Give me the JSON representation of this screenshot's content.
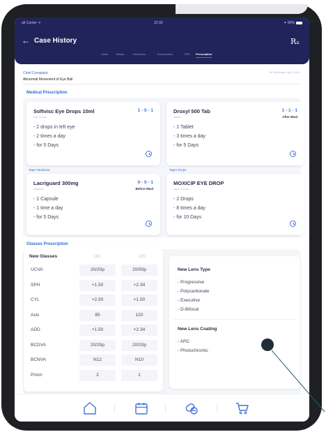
{
  "status": {
    "carrier": "atl Carrier ᯤ",
    "time": "22:33",
    "battery": "✦ 80%"
  },
  "header": {
    "back_symbol": "←",
    "title": "Case History",
    "rx_symbol": "Rₓ"
  },
  "tabs": [
    {
      "label": "Vitals",
      "active": false
    },
    {
      "label": "History",
      "active": false
    },
    {
      "label": "Refraction",
      "active": false
    },
    {
      "label": "Examination",
      "active": false
    },
    {
      "label": "PDC",
      "active": false
    },
    {
      "label": "Prescription",
      "active": true
    }
  ],
  "chief_complaint": {
    "label": "Chief Complaint",
    "meta": "Dr. Eric Brown | Sep 1 2021",
    "value": "Abnormal Movement of Eye Ball"
  },
  "medical_prescription": {
    "title": "Medical Prescription",
    "cards": [
      {
        "name": "Softvisc Eye Drops 10ml",
        "type": "Eye Drops",
        "dose": "1 - 0 - 1",
        "when": "",
        "lines": [
          "- 2 drops in left eye",
          "- 2 times a day",
          "- for 5 Days"
        ],
        "taper_label": "Taper Medicine"
      },
      {
        "name": "Droxyl 500 Tab",
        "type": "Tablet",
        "dose": "1 - 1 - 1",
        "when": "After Meal",
        "lines": [
          "- 1 Tablet",
          "- 3 times a day",
          "- for 5 Days"
        ],
        "taper_label": "Taper Drops"
      },
      {
        "name": "Lacriguard 300mg",
        "type": "Capsule",
        "dose": "0 - 0 - 1",
        "when": "Before Meal",
        "lines": [
          "- 1 Capsule",
          "- 1 time a day",
          "- for 5 Days"
        ],
        "taper_label": ""
      },
      {
        "name": "MOXICIP EYE DROP",
        "type": "Taper Drops",
        "dose": "",
        "when": "",
        "lines": [
          "- 2 Drops",
          "- 8 times a day",
          "- for 10 Days"
        ],
        "taper_label": ""
      }
    ]
  },
  "glasses_prescription": {
    "title": "Glasses Prescription",
    "table": {
      "heading": "New Glasses",
      "col_od": "OD",
      "col_os": "OS",
      "rows": [
        {
          "label": "UCVA",
          "od": "20/20p",
          "os": "20/50p"
        },
        {
          "label": "SPH",
          "od": "+1.50",
          "os": "+2.34"
        },
        {
          "label": "CYL",
          "od": "+2.50",
          "os": "+1.50"
        },
        {
          "label": "Axis",
          "od": "85",
          "os": "120"
        },
        {
          "label": "ADD",
          "od": "+1.50",
          "os": "+2.34"
        },
        {
          "label": "BCDVA",
          "od": "20/25p",
          "os": "20/20p"
        },
        {
          "label": "BCNVA",
          "od": "N12",
          "os": "N10"
        },
        {
          "label": "Prism",
          "od": "2",
          "os": "1"
        }
      ]
    },
    "lens_type": {
      "title": "New Lens Type",
      "items": [
        "- Progressive",
        "- Polycarbonate",
        "- Executive",
        "- D-Bifocal"
      ]
    },
    "lens_coating": {
      "title": "New Lens Coating",
      "items": [
        "- ARC",
        "- Photochromic"
      ]
    }
  },
  "bottom_nav": [
    {
      "icon": "home-icon"
    },
    {
      "icon": "calendar-icon"
    },
    {
      "icon": "pills-icon"
    },
    {
      "icon": "cart-icon"
    }
  ],
  "colors": {
    "header": "#20245a",
    "accent": "#3e72d8",
    "link": "#2f6fd1"
  }
}
